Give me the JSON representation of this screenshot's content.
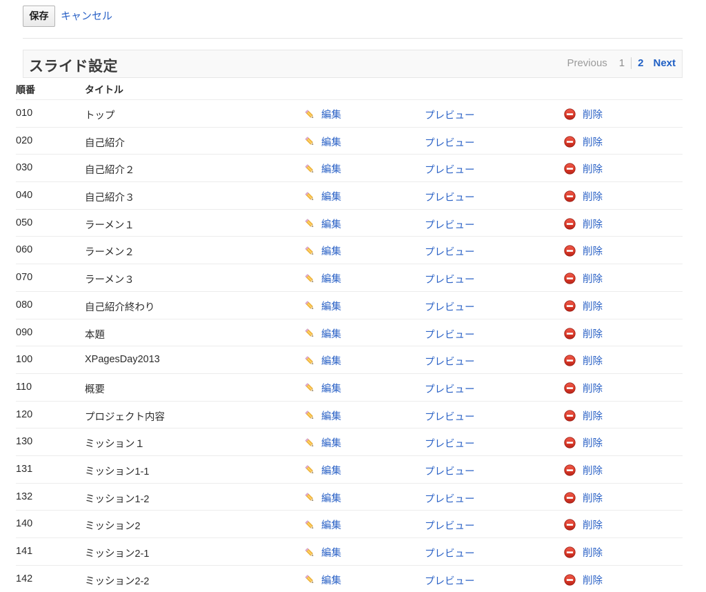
{
  "toolbar": {
    "save_label": "保存",
    "cancel_label": "キャンセル"
  },
  "panel": {
    "title": "スライド設定",
    "pager": {
      "previous_label": "Previous",
      "page_1_label": "1",
      "page_2_label": "2",
      "next_label": "Next",
      "current_page": "2"
    }
  },
  "table": {
    "columns": {
      "order": "順番",
      "title": "タイトル"
    },
    "actions": {
      "edit_label": "編集",
      "preview_label": "プレビュー",
      "delete_label": "削除",
      "edit_icon": "pencil-icon",
      "delete_icon": "delete-circle-icon"
    },
    "rows": [
      {
        "order": "010",
        "title": "トップ"
      },
      {
        "order": "020",
        "title": "自己紹介"
      },
      {
        "order": "030",
        "title": "自己紹介２"
      },
      {
        "order": "040",
        "title": "自己紹介３"
      },
      {
        "order": "050",
        "title": "ラーメン１"
      },
      {
        "order": "060",
        "title": "ラーメン２"
      },
      {
        "order": "070",
        "title": "ラーメン３"
      },
      {
        "order": "080",
        "title": "自己紹介終わり"
      },
      {
        "order": "090",
        "title": "本題"
      },
      {
        "order": "100",
        "title": "XPagesDay2013"
      },
      {
        "order": "110",
        "title": "概要"
      },
      {
        "order": "120",
        "title": "プロジェクト内容"
      },
      {
        "order": "130",
        "title": "ミッション１"
      },
      {
        "order": "131",
        "title": "ミッション1-1"
      },
      {
        "order": "132",
        "title": "ミッション1-2"
      },
      {
        "order": "140",
        "title": "ミッション2"
      },
      {
        "order": "141",
        "title": "ミッション2-1"
      },
      {
        "order": "142",
        "title": "ミッション2-2"
      }
    ]
  },
  "colors": {
    "link": "#2b62c6",
    "pager_active": "#1f5fc4",
    "pencil_body": "#f5a623",
    "delete_red": "#d93025"
  }
}
